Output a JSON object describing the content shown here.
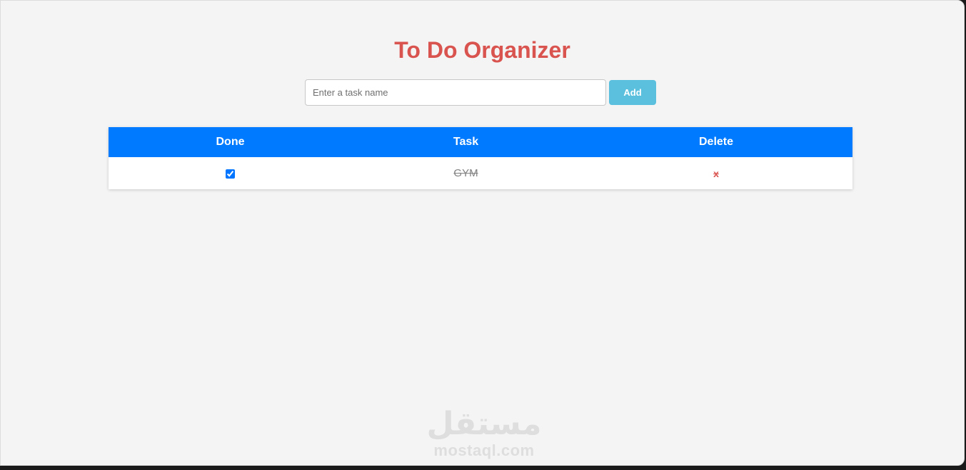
{
  "app": {
    "title": "To Do Organizer"
  },
  "form": {
    "input_placeholder": "Enter a task name",
    "input_value": "",
    "add_label": "Add"
  },
  "table": {
    "headers": {
      "done": "Done",
      "task": "Task",
      "delete": "Delete"
    },
    "rows": [
      {
        "done": true,
        "task": "GYM",
        "delete_label": "x"
      }
    ]
  },
  "watermark": {
    "arabic": "مستقل",
    "latin": "mostaql.com"
  },
  "colors": {
    "title": "#d9534f",
    "header_bg": "#007bff",
    "add_button": "#5bc0de",
    "delete": "#d9534f"
  }
}
